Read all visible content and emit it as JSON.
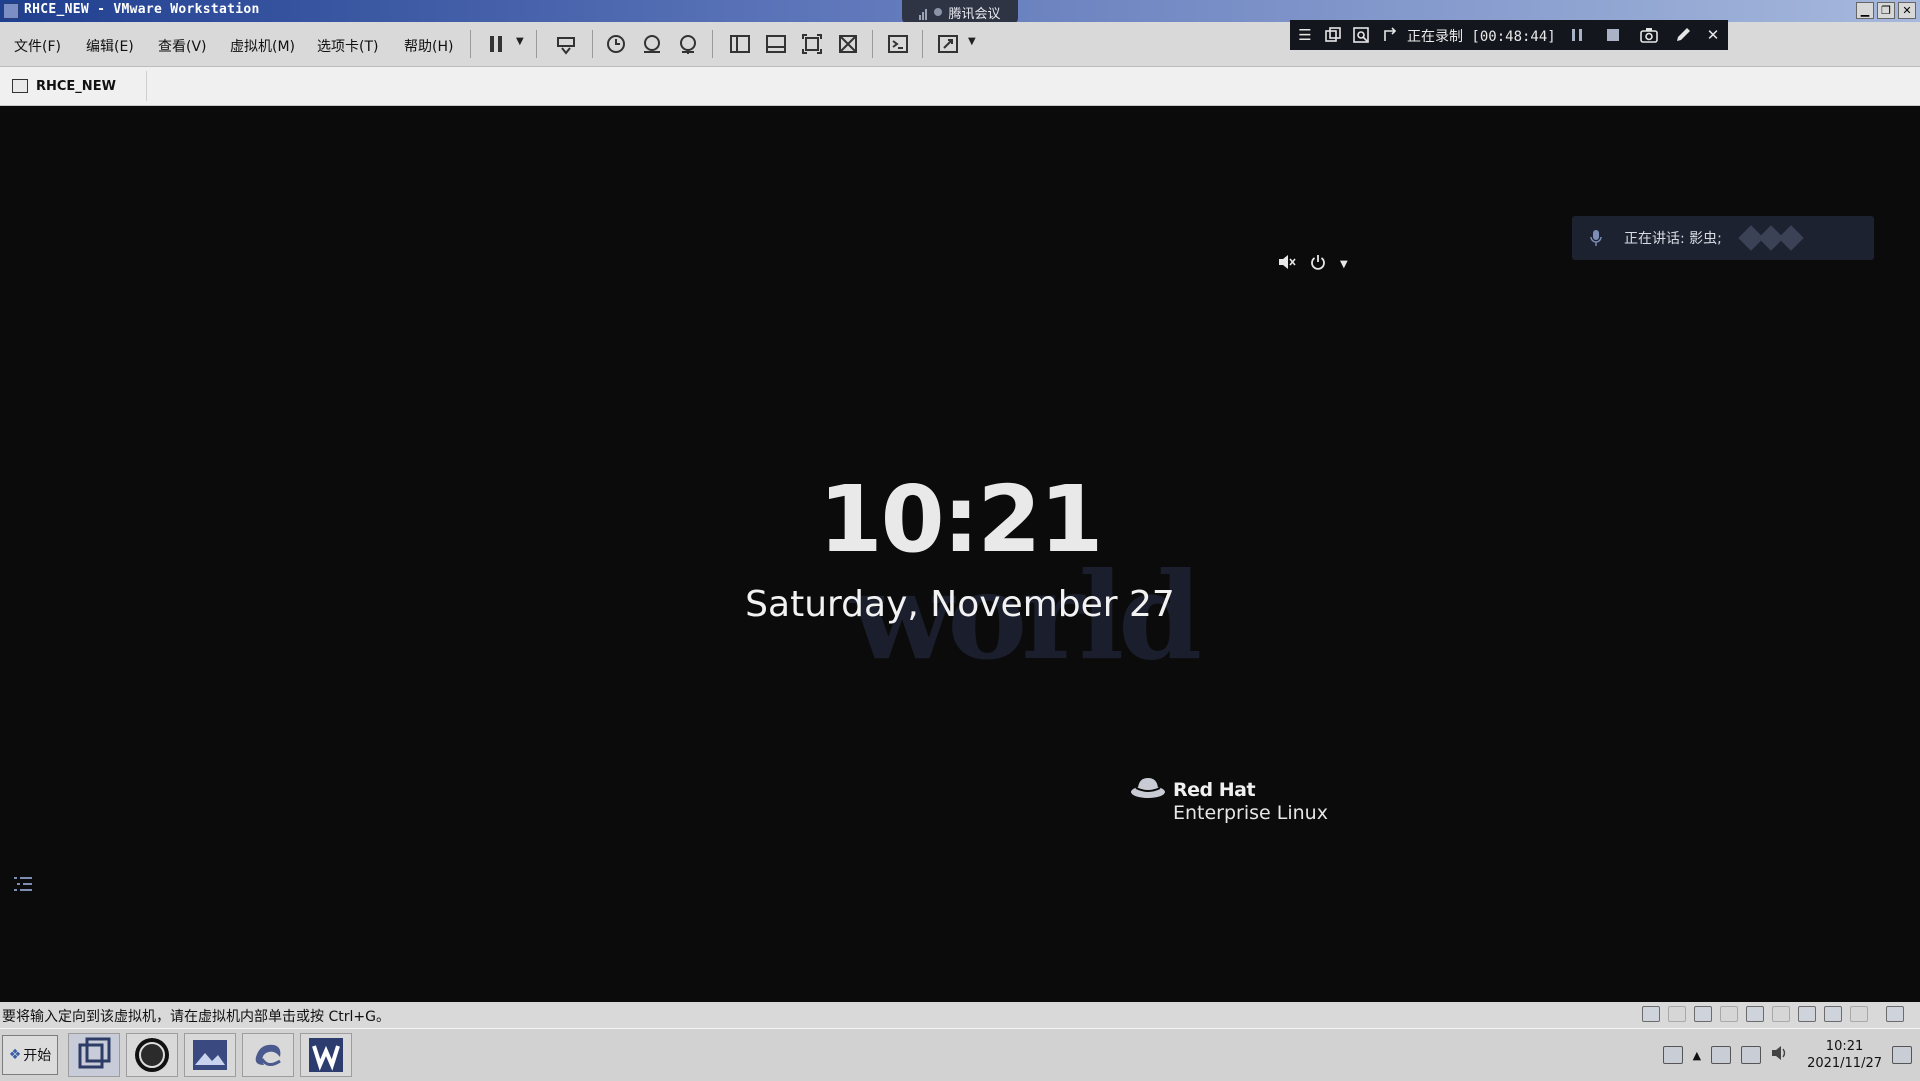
{
  "titlebar": {
    "title": "RHCE_NEW - VMware Workstation",
    "meeting_label": "腾讯会议",
    "buttons": [
      "minimize",
      "restore",
      "close"
    ]
  },
  "menu": {
    "items": [
      "文件(F)",
      "编辑(E)",
      "查看(V)",
      "虚拟机(M)",
      "选项卡(T)",
      "帮助(H)"
    ]
  },
  "recording": {
    "status": "正在录制 [00:48:44]"
  },
  "tab": {
    "vm_name": "RHCE_NEW"
  },
  "vm_screen": {
    "time": "10:21",
    "date": "Saturday, November 27",
    "speaking": "正在讲话: 影虫;",
    "brand_line1": "Red Hat",
    "brand_line2": "Enterprise Linux",
    "watermark_text": "world"
  },
  "statusbar": {
    "message": "要将输入定向到该虚拟机，请在虚拟机内部单击或按 Ctrl+G。"
  },
  "taskbar": {
    "start_label": "开始",
    "clock_time": "10:21",
    "clock_date": "2021/11/27"
  },
  "colors": {
    "titlebar_start": "#1f3f8f",
    "vm_background": "#0b0b0b",
    "chrome": "#d9d9d9"
  }
}
